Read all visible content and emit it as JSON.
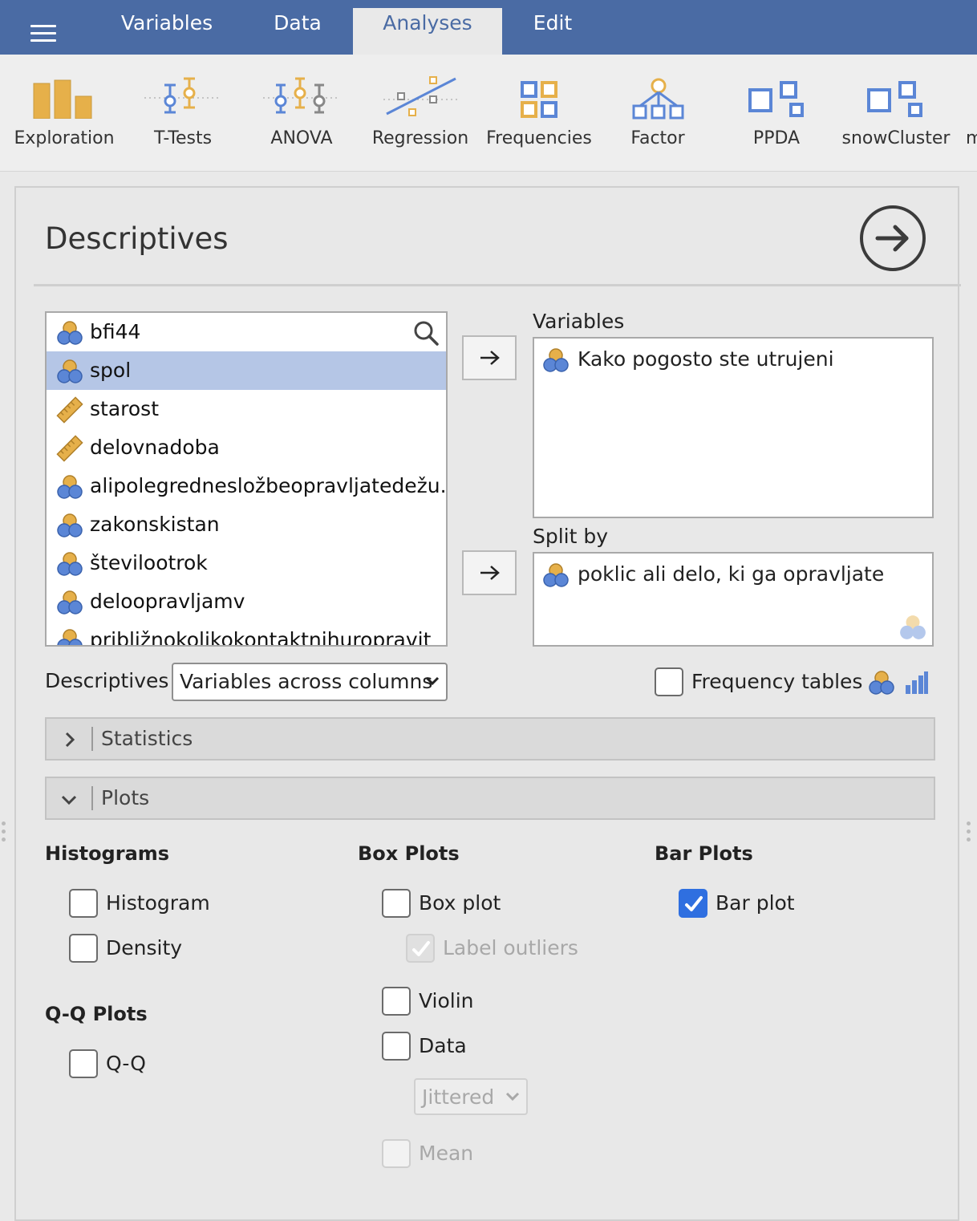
{
  "tabs": [
    {
      "label": "Variables",
      "active": false
    },
    {
      "label": "Data",
      "active": false
    },
    {
      "label": "Analyses",
      "active": true
    },
    {
      "label": "Edit",
      "active": false
    }
  ],
  "ribbon": [
    {
      "label": "Exploration",
      "icon": "bar-chart-icon"
    },
    {
      "label": "T-Tests",
      "icon": "t-test-icon"
    },
    {
      "label": "ANOVA",
      "icon": "anova-icon"
    },
    {
      "label": "Regression",
      "icon": "regression-icon"
    },
    {
      "label": "Frequencies",
      "icon": "frequencies-icon"
    },
    {
      "label": "Factor",
      "icon": "factor-icon"
    },
    {
      "label": "PPDA",
      "icon": "module-icon"
    },
    {
      "label": "snowCluster",
      "icon": "module-icon"
    },
    {
      "label": "m",
      "icon": "more-icon"
    }
  ],
  "panel": {
    "title": "Descriptives"
  },
  "variables_list": [
    {
      "name": "bfi44",
      "type": "nominal",
      "selected": false
    },
    {
      "name": "spol",
      "type": "nominal",
      "selected": true
    },
    {
      "name": "starost",
      "type": "continuous",
      "selected": false
    },
    {
      "name": "delovnadoba",
      "type": "continuous",
      "selected": false
    },
    {
      "name": "alipolegrednesložbeopravljatedežu...",
      "type": "nominal",
      "selected": false
    },
    {
      "name": "zakonskistan",
      "type": "nominal",
      "selected": false
    },
    {
      "name": "številootrok",
      "type": "nominal",
      "selected": false
    },
    {
      "name": "deloopravljamv",
      "type": "nominal",
      "selected": false
    },
    {
      "name": "približnokolikokontaktnihuropravit",
      "type": "nominal",
      "selected": false
    }
  ],
  "targets": {
    "variables": {
      "label": "Variables",
      "items": [
        "Kako pogosto ste utrujeni"
      ]
    },
    "split_by": {
      "label": "Split by",
      "items": [
        "poklic ali delo, ki ga opravljate"
      ]
    }
  },
  "descriptives_row": {
    "label": "Descriptives",
    "select_value": "Variables across columns",
    "freq_label": "Frequency tables",
    "freq_checked": false
  },
  "sections": {
    "statistics": "Statistics",
    "plots": "Plots"
  },
  "plots": {
    "histograms": {
      "title": "Histograms",
      "histogram": "Histogram",
      "density": "Density"
    },
    "qq": {
      "title": "Q-Q Plots",
      "qq": "Q-Q"
    },
    "box": {
      "title": "Box Plots",
      "box_plot": "Box plot",
      "label_outliers": "Label outliers",
      "violin": "Violin",
      "data": "Data",
      "data_type": "Jittered",
      "mean": "Mean"
    },
    "bar": {
      "title": "Bar Plots",
      "bar_plot": "Bar plot",
      "bar_checked": true
    }
  },
  "colors": {
    "accent": "#4a6ba4",
    "checkbox": "#2f6fe0",
    "selected_row": "#b5c6e6",
    "icon_orange": "#e6b04a",
    "icon_blue": "#5b86d6"
  }
}
